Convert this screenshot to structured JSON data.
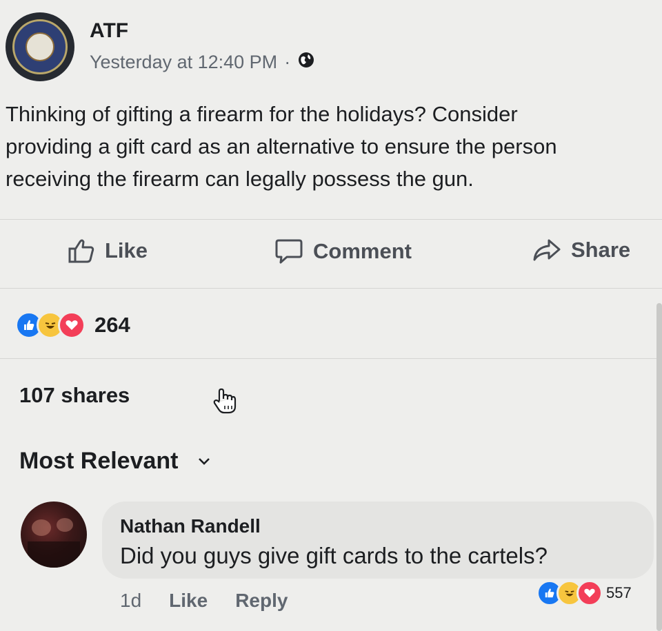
{
  "post": {
    "author": "ATF",
    "timestamp": "Yesterday at 12:40 PM",
    "separator": "·",
    "privacy_icon": "globe-icon",
    "text_lines": [
      "Thinking of gifting a firearm for the holidays? Consider",
      "providing a gift card as an alternative to ensure the person",
      "receiving the firearm can legally possess the gun."
    ]
  },
  "actions": {
    "like": "Like",
    "comment": "Comment",
    "share": "Share"
  },
  "reactions": {
    "count": "264",
    "types": [
      "like",
      "haha",
      "love"
    ]
  },
  "shares": "107 shares",
  "sort": {
    "label": "Most Relevant"
  },
  "comment": {
    "name": "Nathan Randell",
    "text": "Did you guys give gift cards to the cartels?",
    "age": "1d",
    "like": "Like",
    "reply": "Reply",
    "reaction_count": "557"
  },
  "colors": {
    "like_blue": "#1877f2",
    "haha_yellow": "#f7c53e",
    "love_red": "#f33e58"
  }
}
